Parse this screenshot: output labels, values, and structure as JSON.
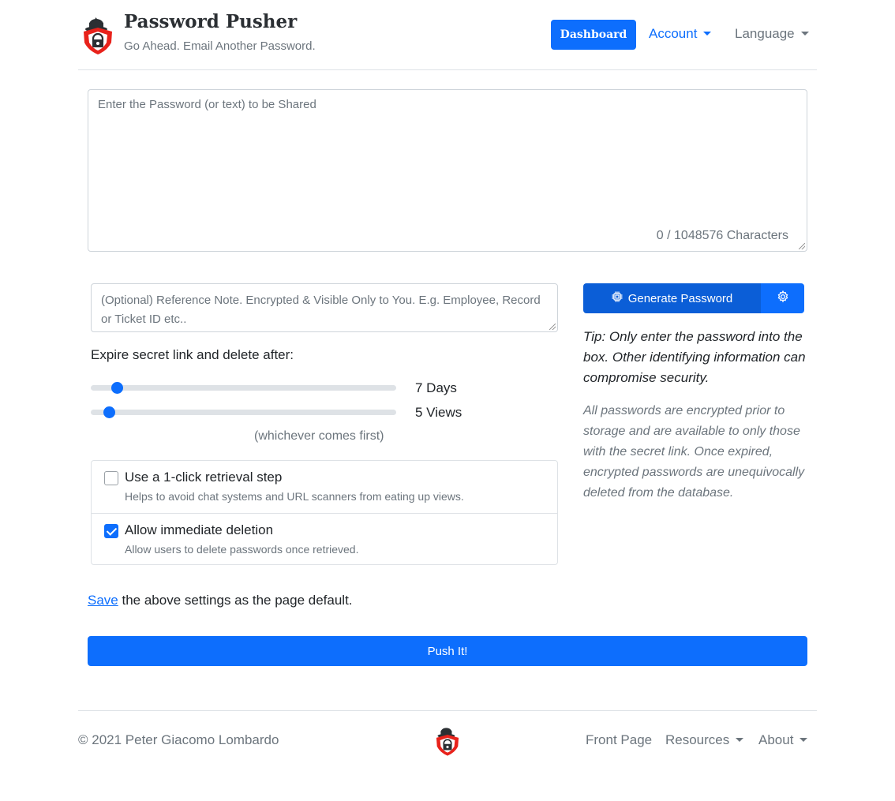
{
  "header": {
    "app_name": "Password Pusher",
    "tagline": "Go Ahead. Email Another Password.",
    "dashboard_label": "Dashboard",
    "account_label": "Account",
    "language_label": "Language"
  },
  "form": {
    "password_placeholder": "Enter the Password (or text) to be Shared",
    "char_counter": "0 / 1048576 Characters",
    "note_placeholder": "(Optional) Reference Note. Encrypted & Visible Only to You. E.g. Employee, Record or Ticket ID etc..",
    "expire_label": "Expire secret link and delete after:",
    "days": {
      "value": 7,
      "text": "7 Days",
      "max": 90,
      "min": 1
    },
    "views": {
      "value": 5,
      "text": "5 Views",
      "max": 100,
      "min": 1
    },
    "whichever": "(whichever comes first)",
    "options": [
      {
        "title": "Use a 1-click retrieval step",
        "help": "Helps to avoid chat systems and URL scanners from eating up views.",
        "checked": false
      },
      {
        "title": "Allow immediate deletion",
        "help": "Allow users to delete passwords once retrieved.",
        "checked": true
      }
    ],
    "save_link": "Save",
    "save_suffix": " the above settings as the page default.",
    "push_label": "Push It!"
  },
  "sidebar": {
    "generate_label": "Generate Password",
    "tip": "Tip: Only enter the password into the box. Other identifying information can compromise security.",
    "info": "All passwords are encrypted prior to storage and are available to only those with the secret link. Once expired, encrypted passwords are unequivocally deleted from the database."
  },
  "footer": {
    "copyright": "© 2021 Peter Giacomo Lombardo",
    "front_page": "Front Page",
    "resources": "Resources",
    "about": "About"
  },
  "colors": {
    "primary": "#0d6efd",
    "primary_dark": "#0b5ed7",
    "muted": "#6c757d",
    "logo_red": "#e8221b"
  },
  "icons": {
    "logo": "pusher-shield-logo",
    "generate": "cpu-chip-icon",
    "settings": "gear-icon"
  }
}
